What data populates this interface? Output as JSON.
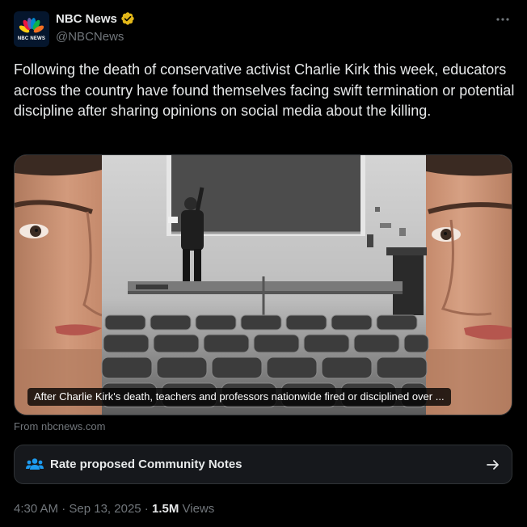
{
  "account": {
    "display_name": "NBC News",
    "handle": "@NBCNews",
    "verified_color": "#f2b705",
    "avatar_text": "NBC NEWS"
  },
  "tweet": {
    "text": "Following the death of conservative activist Charlie Kirk this week, educators across the country have found themselves facing swift termination or potential discipline after sharing opinions on social media about the killing."
  },
  "media": {
    "caption": "After Charlie Kirk's death, teachers and professors nationwide fired or disciplined over ..."
  },
  "link_source": "From nbcnews.com",
  "community_notes": {
    "label": "Rate proposed Community Notes",
    "icon_color": "#1d9bf0"
  },
  "meta": {
    "time": "4:30 AM",
    "separator": " · ",
    "date": "Sep 13, 2025",
    "views_count": "1.5M",
    "views_label": " Views"
  },
  "icons": {
    "more": "more-horizontal-icon",
    "notes": "people-icon",
    "arrow": "arrow-right-icon"
  }
}
